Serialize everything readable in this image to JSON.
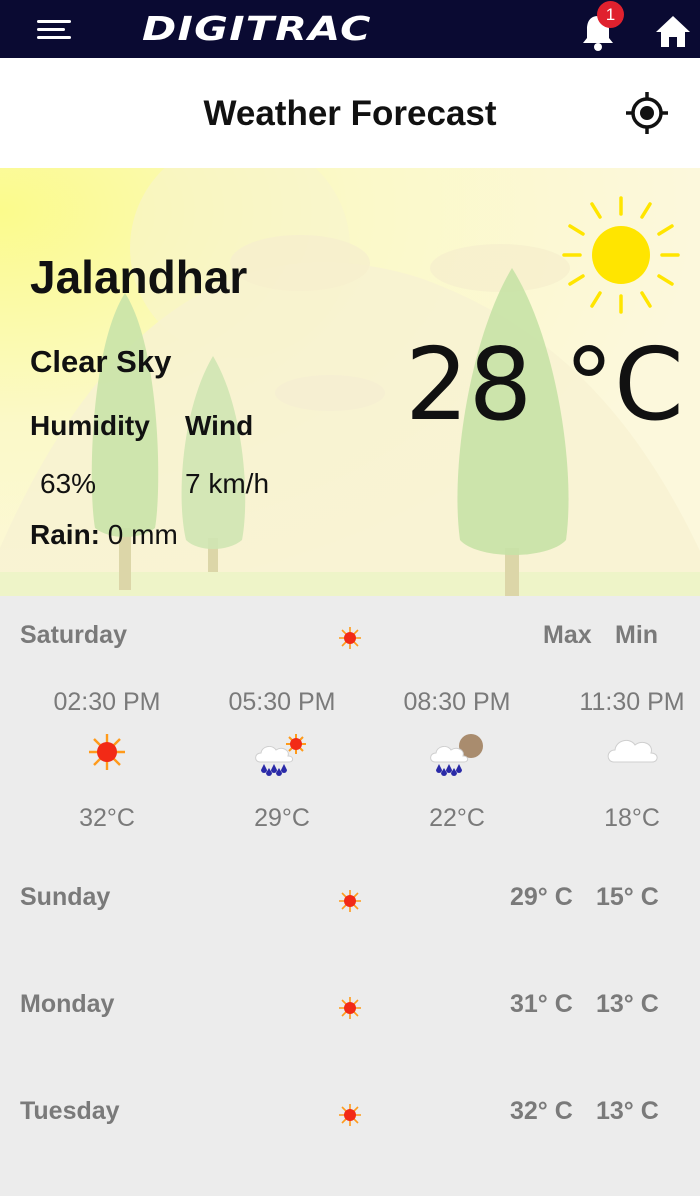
{
  "app": {
    "brand": "DIGITRAC",
    "notification_count": "1"
  },
  "header": {
    "title": "Weather Forecast"
  },
  "current": {
    "city": "Jalandhar",
    "condition": "Clear Sky",
    "humidity_label": "Humidity",
    "humidity_value": "63%",
    "wind_label": "Wind",
    "wind_value": "7 km/h",
    "rain_label": "Rain:",
    "rain_value": " 0 mm",
    "temperature": "28 °C"
  },
  "today": {
    "day": "Saturday",
    "max_label": "Max",
    "min_label": "Min",
    "hourly": [
      {
        "time": "02:30 PM",
        "icon": "sun-icon",
        "temp": "32°C"
      },
      {
        "time": "05:30 PM",
        "icon": "rain-sun-icon",
        "temp": "29°C"
      },
      {
        "time": "08:30 PM",
        "icon": "rain-moon-icon",
        "temp": "22°C"
      },
      {
        "time": "11:30 PM",
        "icon": "cloud-icon",
        "temp": "18°C"
      }
    ]
  },
  "daily": [
    {
      "day": "Sunday",
      "icon": "sun-icon",
      "max": "29° C",
      "min": "15° C"
    },
    {
      "day": "Monday",
      "icon": "sun-icon",
      "max": "31° C",
      "min": "13° C"
    },
    {
      "day": "Tuesday",
      "icon": "sun-icon",
      "max": "32° C",
      "min": "13° C"
    }
  ],
  "colors": {
    "topbar": "#0a0a32",
    "badge": "#e0212e",
    "sun": "#ffe500",
    "text": "#111111",
    "muted": "#7a7a7a",
    "panel": "#ececec"
  }
}
